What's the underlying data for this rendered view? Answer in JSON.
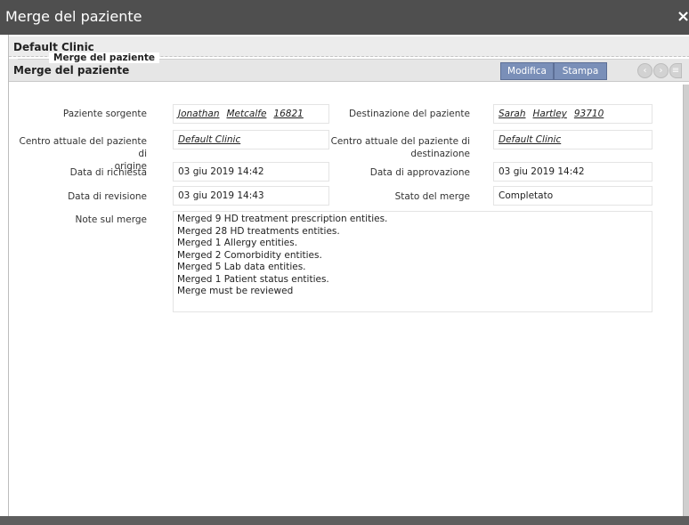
{
  "window": {
    "title": "Merge del paziente",
    "close_glyph": "×"
  },
  "clinic_bar": {
    "label": "Default Clinic"
  },
  "section": {
    "label": "Merge del paziente",
    "edit_label": "Modifica",
    "print_label": "Stampa",
    "nav_prev_icon": "chevron-left-icon",
    "nav_next_icon": "chevron-right-icon",
    "nav_menu_icon": "menu-icon"
  },
  "fieldset": {
    "legend": "Merge del paziente"
  },
  "fields": {
    "source_patient_label": "Paziente sorgente",
    "source_patient": {
      "first": "Jonathan",
      "last": "Metcalfe",
      "id": "16821"
    },
    "dest_patient_label": "Destinazione del paziente",
    "dest_patient": {
      "first": "Sarah",
      "last": "Hartley",
      "id": "93710"
    },
    "origin_center_label_1": "Centro attuale del paziente di",
    "origin_center_label_2": "origine",
    "origin_center": "Default Clinic",
    "dest_center_label_1": "Centro attuale del paziente di",
    "dest_center_label_2": "destinazione",
    "dest_center": "Default Clinic",
    "request_date_label": "Data di richiesta",
    "request_date": "03 giu 2019 14:42",
    "approval_date_label": "Data di approvazione",
    "approval_date": "03 giu 2019 14:42",
    "revision_date_label": "Data di revisione",
    "revision_date": "03 giu 2019 14:43",
    "merge_status_label": "Stato del merge",
    "merge_status": "Completato",
    "notes_label": "Note sul merge",
    "notes": [
      "Merged 9 HD treatment prescription entities.",
      "Merged 28 HD treatments entities.",
      "Merged 1 Allergy entities.",
      "Merged 2 Comorbidity entities.",
      "Merged 5 Lab data entities.",
      "Merged 1 Patient status entities.",
      "Merge must be reviewed"
    ]
  }
}
